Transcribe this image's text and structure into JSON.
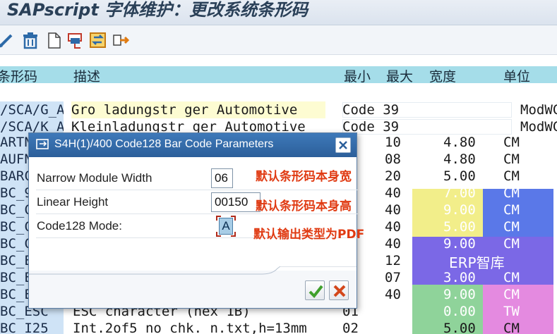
{
  "window": {
    "title": "SAPscript 字体维护：更改系统条形码"
  },
  "toolbar": {
    "icons": [
      "edit-icon",
      "delete-icon",
      "new-document-icon",
      "copy-icon",
      "compare-icon",
      "transport-icon"
    ]
  },
  "table": {
    "headers": {
      "code": "条形码",
      "desc": "描述",
      "min": "最小",
      "max": "最大",
      "width": "宽度",
      "unit": "单位"
    },
    "rows": [
      {
        "code": "/SCA/G_A",
        "desc": "Gro  ladungstr  ger Automotive",
        "min": "Code 39",
        "max": "",
        "width": "",
        "unit": "ModWC"
      },
      {
        "code": "/SCA/K_A",
        "desc": "Kleinladungstr  ger Automotive",
        "min": "Code 39",
        "max": "",
        "width": "",
        "unit": "ModWC"
      },
      {
        "code": "ARTN",
        "desc": "",
        "min": "10",
        "max": "",
        "width": "4.80",
        "unit": "CM"
      },
      {
        "code": "AUFN",
        "desc": "",
        "min": "08",
        "max": "",
        "width": "4.80",
        "unit": "CM"
      },
      {
        "code": "BARC",
        "desc": "",
        "min": "20",
        "max": "",
        "width": "5.00",
        "unit": "CM"
      },
      {
        "code": "BC_9",
        "desc": "",
        "min": "40",
        "max": "",
        "width": "7.00",
        "unit": "CM"
      },
      {
        "code": "BC_C",
        "desc": "",
        "min": "40",
        "max": "",
        "width": "9.00",
        "unit": "CM"
      },
      {
        "code": "BC_C",
        "desc": "",
        "min": "40",
        "max": "",
        "width": "5.00",
        "unit": "CM"
      },
      {
        "code": "BC_C",
        "desc": "",
        "min": "40",
        "max": "",
        "width": "9.00",
        "unit": "CM"
      },
      {
        "code": "BC_E",
        "desc": "",
        "min": "12",
        "max": "",
        "width": "",
        "unit": ""
      },
      {
        "code": "BC_E",
        "desc": "",
        "min": "07",
        "max": "",
        "width": "3.00",
        "unit": "CM"
      },
      {
        "code": "BC_E",
        "desc": "",
        "min": "40",
        "max": "",
        "width": "9.00",
        "unit": "CM"
      },
      {
        "code": "BC_ESC",
        "desc": "ESC character (hex 1B)",
        "min": "01",
        "max": "",
        "width": "0.00",
        "unit": "TW"
      },
      {
        "code": "BC_I25",
        "desc": "Int.2of5 no chk.  n.txt,h=13mm",
        "min": "02",
        "max": "",
        "width": "5.00",
        "unit": "CM"
      }
    ]
  },
  "dialog": {
    "title": "S4H(1)/400 Code128 Bar Code Parameters",
    "fields": [
      {
        "label": "Narrow Module Width",
        "value": "06"
      },
      {
        "label": "Linear Height",
        "value": "00150"
      },
      {
        "label": "Code128 Mode:",
        "value": "A"
      }
    ],
    "annotations": [
      "默认条形码本身宽",
      "默认条形码本身高",
      "默认输出类型为PDF"
    ]
  },
  "watermark": {
    "text": "ERP智库"
  },
  "colors": {
    "title_bar": "#2c5f9a",
    "annotation": "#e03a12",
    "header_band": "#a5dde9"
  }
}
